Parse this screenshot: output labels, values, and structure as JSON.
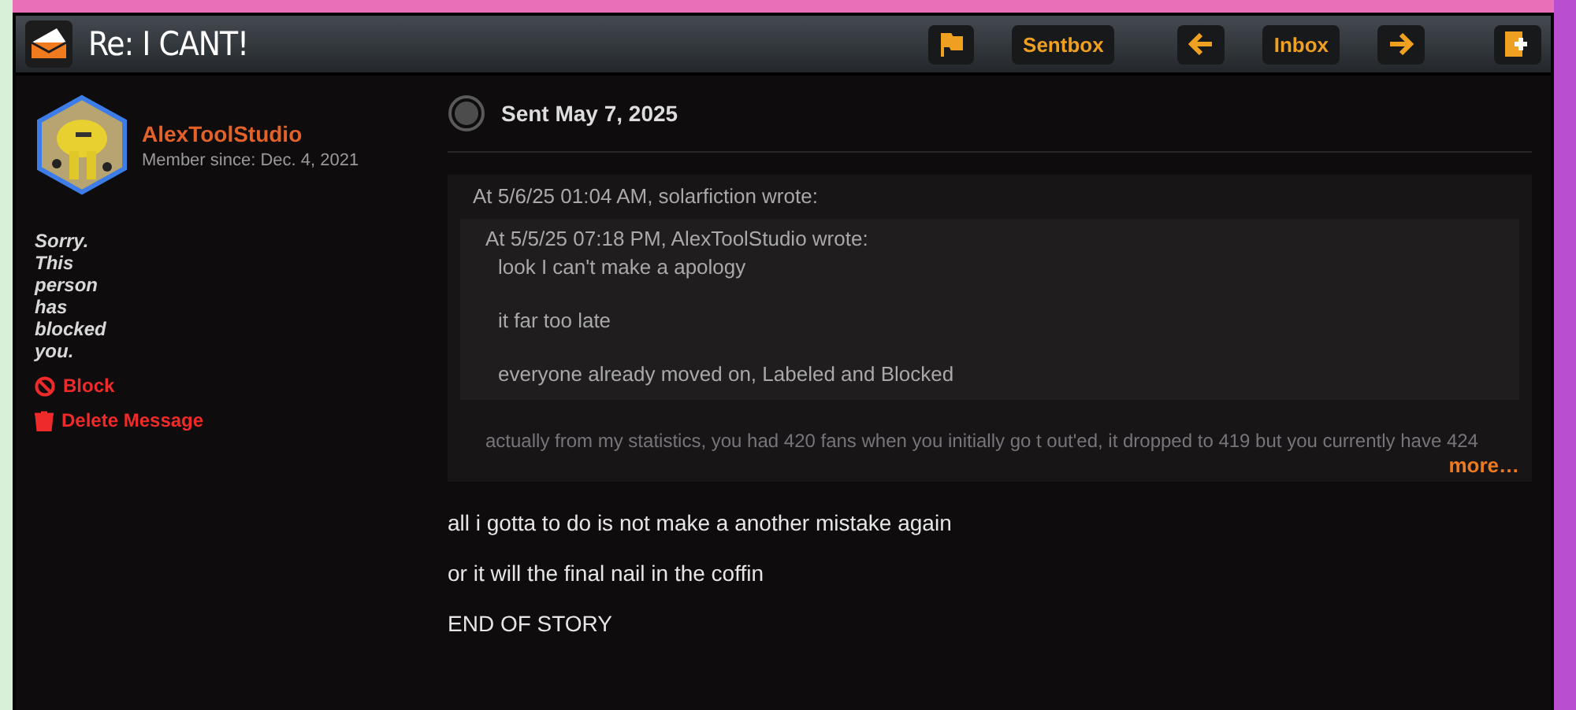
{
  "window": {
    "title": "Re: I CANT!"
  },
  "toolbar": [
    {
      "kind": "flag"
    },
    {
      "kind": "text",
      "label": "Sentbox"
    },
    {
      "kind": "prev"
    },
    {
      "kind": "text",
      "label": "Inbox"
    },
    {
      "kind": "next"
    },
    {
      "kind": "new"
    }
  ],
  "sender": {
    "name": "AlexToolStudio",
    "member_since": "Member since: Dec. 4, 2021"
  },
  "blocked_notice": "Sorry. This person has blocked you.",
  "actions": [
    {
      "kind": "block",
      "label": "Block"
    },
    {
      "kind": "delete",
      "label": "Delete Message"
    }
  ],
  "message": {
    "status": "Sent May 7, 2025",
    "quote": {
      "header": "At 5/6/25 01:04 AM, solarfiction wrote:",
      "inner": {
        "header": "At 5/5/25 07:18 PM, AlexToolStudio wrote:",
        "lines": [
          "look I can't make a apology",
          "it far too late",
          "everyone already moved on, Labeled and Blocked"
        ]
      },
      "faded_line": "actually from my statistics, you had 420 fans when you initially go t out'ed, it dropped to 419 but you currently have 424",
      "more": "more…"
    },
    "body": [
      "all i gotta to do is not make a another mistake again",
      "or it will the final nail in the coffin",
      "END OF STORY"
    ]
  }
}
